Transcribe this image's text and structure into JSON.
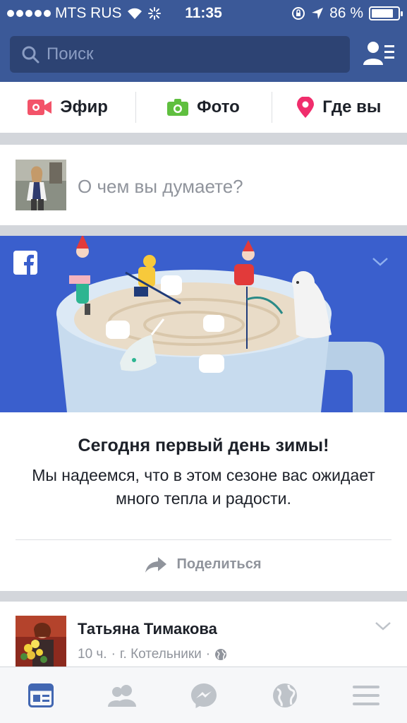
{
  "status_bar": {
    "carrier": "MTS RUS",
    "time": "11:35",
    "battery_percent": "86 %",
    "battery_level": 0.86
  },
  "search": {
    "placeholder": "Поиск"
  },
  "composer_actions": [
    {
      "label": "Эфир",
      "icon": "live-video-icon",
      "color": "#f35369"
    },
    {
      "label": "Фото",
      "icon": "camera-icon",
      "color": "#5fbf3f"
    },
    {
      "label": "Где вы",
      "icon": "location-pin-icon",
      "color": "#f02d6c"
    }
  ],
  "composer": {
    "prompt": "О чем вы думаете?"
  },
  "winter_card": {
    "title": "Сегодня первый день зимы!",
    "description": "Мы надеемся, что в этом сезоне вас ожидает много тепла и радости.",
    "share_label": "Поделиться",
    "banner_color": "#3a5fcd"
  },
  "post": {
    "author": "Татьяна Тимакова",
    "time": "10 ч.",
    "location": "г. Котельники"
  },
  "tabbar": [
    {
      "icon": "news-feed-icon",
      "active": true
    },
    {
      "icon": "friends-icon",
      "active": false
    },
    {
      "icon": "messenger-icon",
      "active": false
    },
    {
      "icon": "globe-icon",
      "active": false
    },
    {
      "icon": "menu-icon",
      "active": false
    }
  ],
  "colors": {
    "brand": "#3b5998",
    "accent": "#4267b2",
    "inactive": "#bec3c9"
  }
}
